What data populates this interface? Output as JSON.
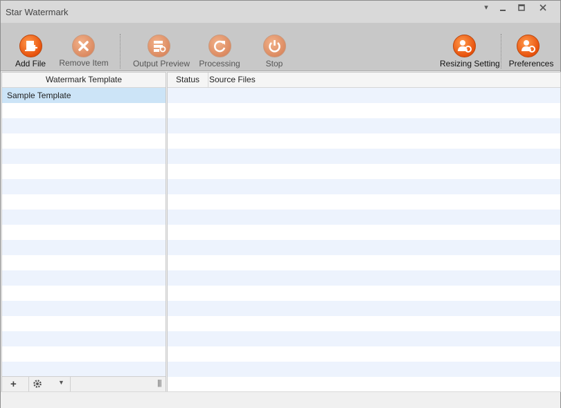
{
  "window": {
    "title": "Star Watermark"
  },
  "toolbar": {
    "add_file": "Add File",
    "remove_item": "Remove Item",
    "output_preview": "Output Preview",
    "processing": "Processing",
    "stop": "Stop",
    "resizing_setting": "Resizing Setting",
    "preferences": "Preferences"
  },
  "templates": {
    "header": "Watermark Template",
    "items": [
      "Sample Template"
    ]
  },
  "files": {
    "col_status": "Status",
    "col_source": "Source Files"
  },
  "colors": {
    "accent": "#e8520d",
    "selection": "#cce4f7",
    "row_alt": "#edf3fd"
  }
}
